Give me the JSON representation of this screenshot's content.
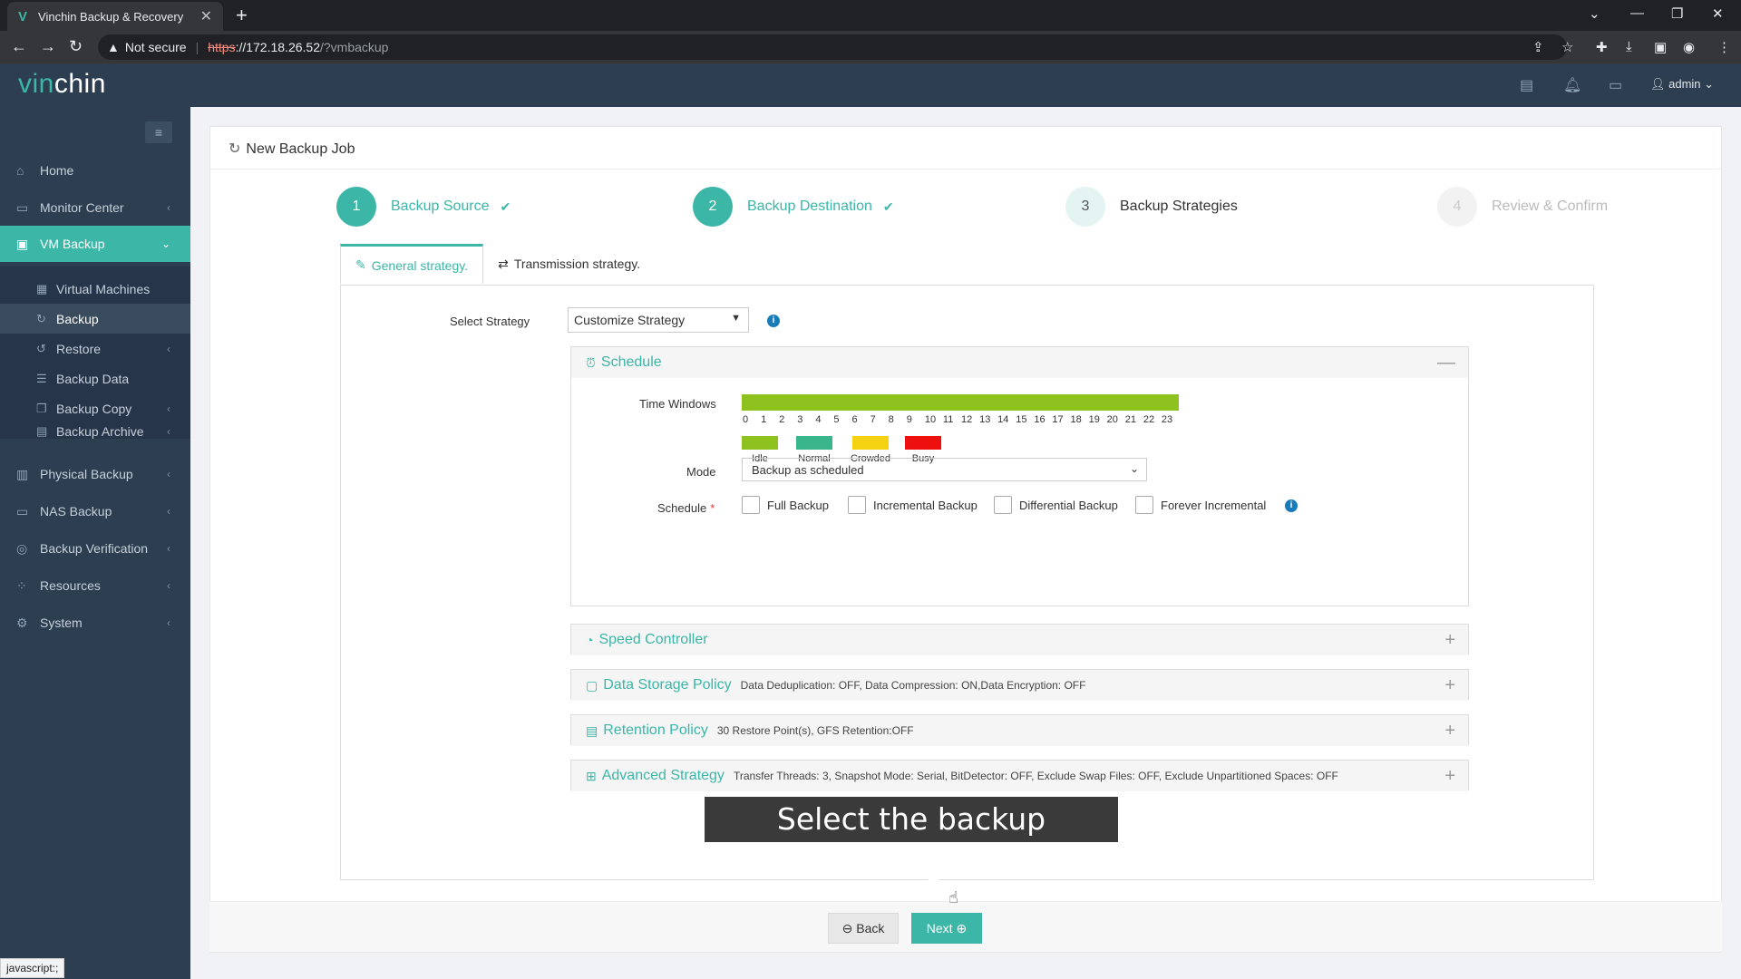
{
  "browser": {
    "tab_title": "Vinchin Backup & Recovery",
    "tab_favicon": "V",
    "new_tab": "+",
    "not_secure": "Not secure",
    "url_scheme": "https",
    "url_host": "://172.18.26.52",
    "url_path": "/?vmbackup",
    "status_text": "javascript:;"
  },
  "app": {
    "logo_a": "vin",
    "logo_b": "chin",
    "user": "admin"
  },
  "sidebar": {
    "items": [
      {
        "label": "Home"
      },
      {
        "label": "Monitor Center"
      },
      {
        "label": "VM Backup"
      },
      {
        "label": "Physical Backup"
      },
      {
        "label": "NAS Backup"
      },
      {
        "label": "Backup Verification"
      },
      {
        "label": "Resources"
      },
      {
        "label": "System"
      }
    ],
    "subitems": [
      {
        "label": "Virtual Machines"
      },
      {
        "label": "Backup"
      },
      {
        "label": "Restore"
      },
      {
        "label": "Backup Data"
      },
      {
        "label": "Backup Copy"
      },
      {
        "label": "Backup Archive"
      }
    ]
  },
  "page": {
    "title": "New Backup Job",
    "steps": [
      {
        "num": "1",
        "label": "Backup Source"
      },
      {
        "num": "2",
        "label": "Backup Destination"
      },
      {
        "num": "3",
        "label": "Backup Strategies"
      },
      {
        "num": "4",
        "label": "Review & Confirm"
      }
    ],
    "tabs": [
      {
        "label": "General strategy."
      },
      {
        "label": "Transmission strategy."
      }
    ],
    "select_strategy_label": "Select Strategy",
    "select_strategy_value": "Customize Strategy"
  },
  "schedule": {
    "title": "Schedule",
    "time_windows_label": "Time Windows",
    "hours": [
      "0",
      "1",
      "2",
      "3",
      "4",
      "5",
      "6",
      "7",
      "8",
      "9",
      "10",
      "11",
      "12",
      "13",
      "14",
      "15",
      "16",
      "17",
      "18",
      "19",
      "20",
      "21",
      "22",
      "23"
    ],
    "legend": [
      {
        "label": "Idle",
        "color": "#8ec31f"
      },
      {
        "label": "Normal",
        "color": "#3bb68c"
      },
      {
        "label": "Crowded",
        "color": "#f5d313"
      },
      {
        "label": "Busy",
        "color": "#ee0f0f"
      }
    ],
    "mode_label": "Mode",
    "mode_value": "Backup as scheduled",
    "schedule_label": "Schedule",
    "required_mark": "*",
    "options": [
      {
        "label": "Full Backup",
        "checked": false
      },
      {
        "label": "Incremental Backup",
        "checked": false
      },
      {
        "label": "Differential Backup",
        "checked": false
      },
      {
        "label": "Forever Incremental",
        "checked": false
      }
    ]
  },
  "panels": [
    {
      "title": "Speed Controller",
      "summary": ""
    },
    {
      "title": "Data Storage Policy",
      "summary": "Data Deduplication: OFF, Data Compression: ON,Data Encryption: OFF"
    },
    {
      "title": "Retention Policy",
      "summary": "30 Restore Point(s), GFS Retention:OFF"
    },
    {
      "title": "Advanced Strategy",
      "summary": "Transfer Threads: 3, Snapshot Mode: Serial, BitDetector: OFF, Exclude Swap Files: OFF, Exclude Unpartitioned Spaces: OFF"
    }
  ],
  "caption": "Select the backup strategies",
  "footer": {
    "back": "Back",
    "next": "Next"
  },
  "colors": {
    "accent": "#3bb6a7",
    "sidebar": "#2d3e50"
  }
}
